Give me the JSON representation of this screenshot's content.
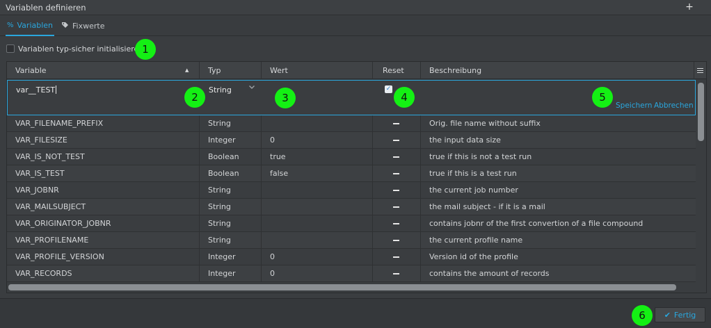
{
  "window": {
    "title": "Variablen definieren",
    "add_label": "+"
  },
  "tabs": [
    {
      "label": "Variablen",
      "icon": "percent-icon"
    },
    {
      "label": "Fixwerte",
      "icon": "tag-icon"
    }
  ],
  "options": {
    "typesafe_label": "Variablen typ-sicher initialisieren",
    "typesafe_checked": false
  },
  "grid": {
    "columns": [
      "Variable",
      "Typ",
      "Wert",
      "Reset",
      "Beschreibung"
    ],
    "sort_indicator": "▲",
    "edit_row": {
      "variable": "var__TEST",
      "typ": "String",
      "wert": "",
      "reset_checked": true,
      "reset_glyph": "✓",
      "save_label": "Speichern",
      "cancel_label": "Abbrechen"
    },
    "rows": [
      {
        "variable": "VAR_FILENAME_PREFIX",
        "typ": "String",
        "wert": "",
        "desc": "Orig. file name without suffix"
      },
      {
        "variable": "VAR_FILESIZE",
        "typ": "Integer",
        "wert": "0",
        "desc": "the input data size"
      },
      {
        "variable": "VAR_IS_NOT_TEST",
        "typ": "Boolean",
        "wert": "true",
        "desc": "true if this is not a test run"
      },
      {
        "variable": "VAR_IS_TEST",
        "typ": "Boolean",
        "wert": "false",
        "desc": "true if this is a test run"
      },
      {
        "variable": "VAR_JOBNR",
        "typ": "String",
        "wert": "",
        "desc": "the current job number"
      },
      {
        "variable": "VAR_MAILSUBJECT",
        "typ": "String",
        "wert": "",
        "desc": "the mail subject - if it is a mail"
      },
      {
        "variable": "VAR_ORIGINATOR_JOBNR",
        "typ": "String",
        "wert": "",
        "desc": "contains jobnr of the first convertion of a file compound"
      },
      {
        "variable": "VAR_PROFILENAME",
        "typ": "String",
        "wert": "",
        "desc": "the current profile name"
      },
      {
        "variable": "VAR_PROFILE_VERSION",
        "typ": "Integer",
        "wert": "0",
        "desc": "Version id of the profile"
      },
      {
        "variable": "VAR_RECORDS",
        "typ": "Integer",
        "wert": "0",
        "desc": "contains the amount of records"
      }
    ]
  },
  "footer": {
    "done_label": "Fertig",
    "done_glyph": "✔"
  },
  "markers": [
    "1",
    "2",
    "3",
    "4",
    "5",
    "6"
  ],
  "colors": {
    "accent": "#2aa7de",
    "marker": "#14f014",
    "background": "#3a3d40"
  }
}
